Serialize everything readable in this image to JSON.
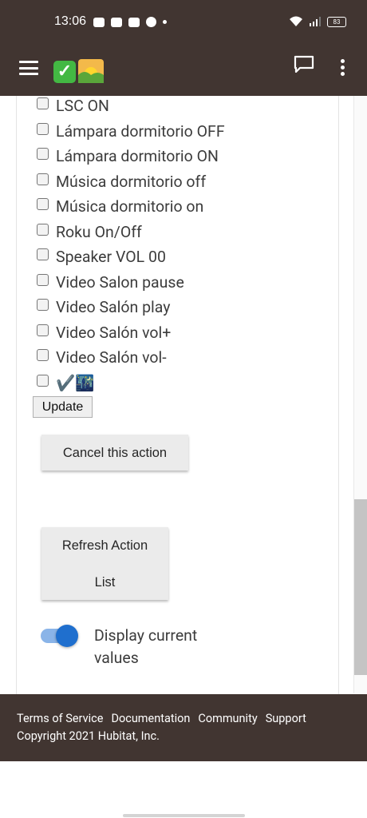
{
  "status_bar": {
    "time": "13:06",
    "battery": "83"
  },
  "actions": [
    {
      "label": "LSC ON"
    },
    {
      "label": "Lámpara dormitorio OFF"
    },
    {
      "label": "Lámpara dormitorio ON"
    },
    {
      "label": "Música dormitorio off"
    },
    {
      "label": "Música dormitorio on"
    },
    {
      "label": "Roku On/Off"
    },
    {
      "label": "Speaker VOL 00"
    },
    {
      "label": "Video Salon pause"
    },
    {
      "label": "Video Salón play"
    },
    {
      "label": "Video Salón vol+"
    },
    {
      "label": "Video Salón vol-"
    },
    {
      "label": "✔️🌃"
    }
  ],
  "buttons": {
    "update": "Update",
    "cancel": "Cancel this action",
    "refresh_line1": "Refresh Action",
    "refresh_line2": "List"
  },
  "toggle": {
    "label_line1": "Display current",
    "label_line2": "values",
    "on": true
  },
  "footer": {
    "links": [
      "Terms of Service",
      "Documentation",
      "Community",
      "Support"
    ],
    "copyright": "Copyright 2021 Hubitat, Inc."
  }
}
